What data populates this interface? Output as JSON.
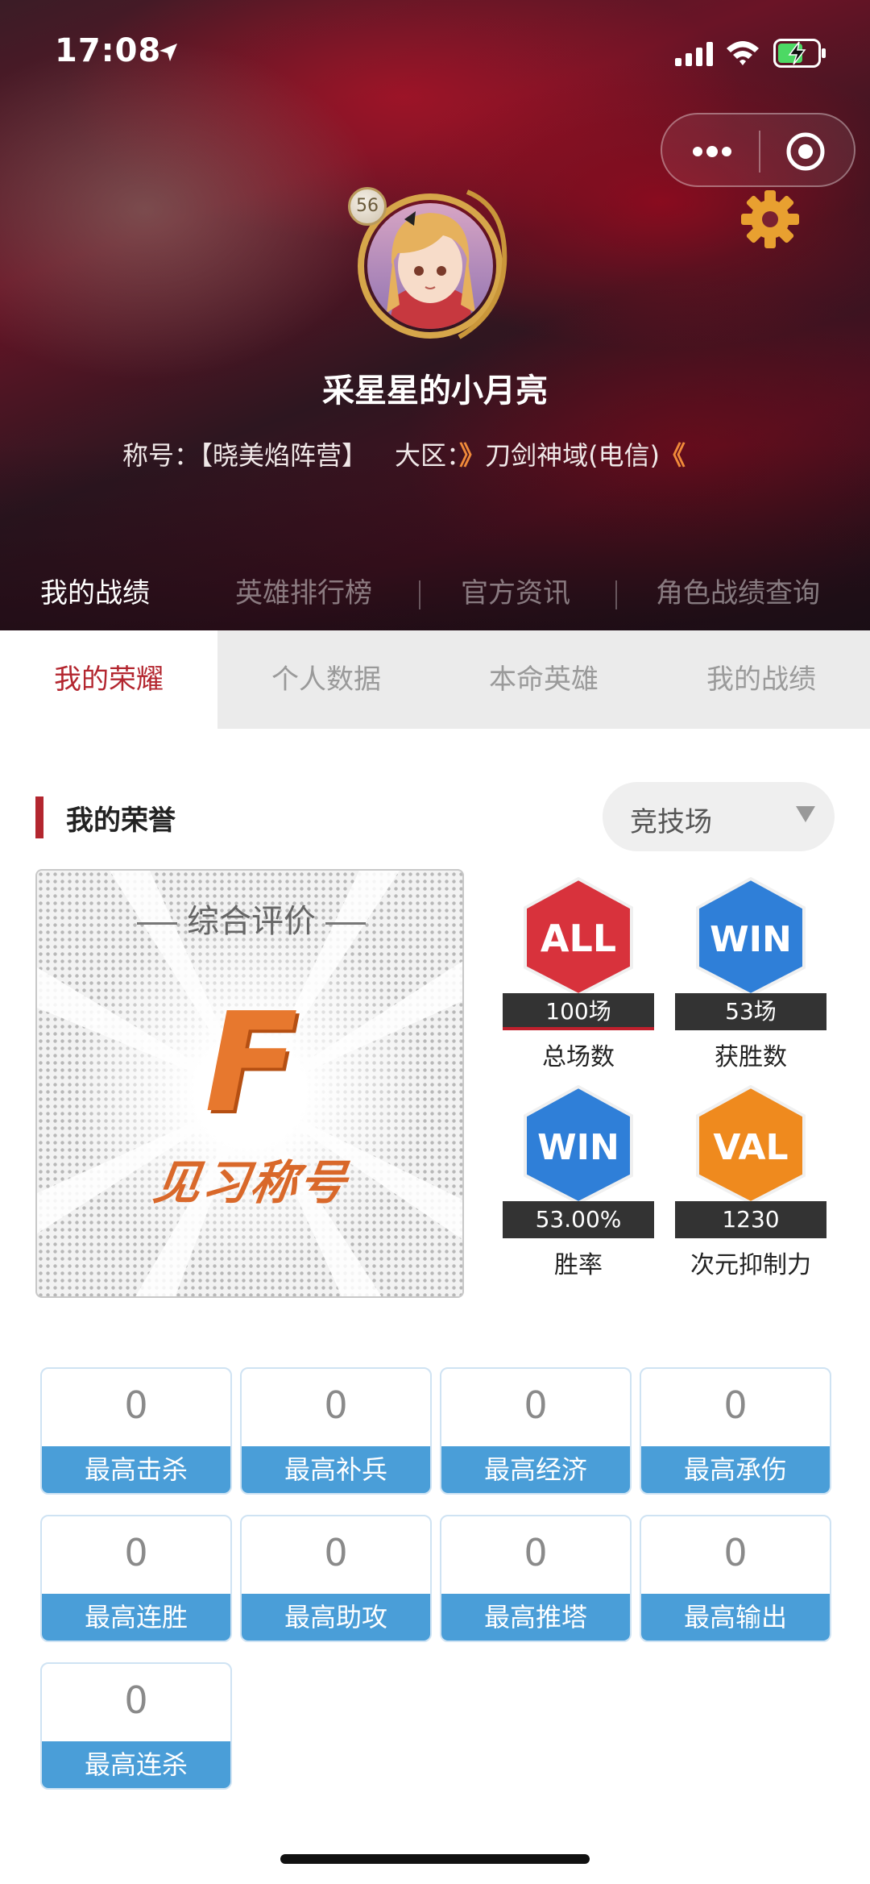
{
  "status_bar": {
    "time": "17:08"
  },
  "profile": {
    "level": "56",
    "username": "采星星的小月亮",
    "title_label": "称号：",
    "title_value": "【晓美焰阵营】",
    "region_label": "大区：",
    "region_left_mark": "》",
    "region_value": "刀剑神域(电信)",
    "region_right_mark": "《"
  },
  "top_tabs": [
    "我的战绩",
    "英雄排行榜",
    "官方资讯",
    "角色战绩查询"
  ],
  "sub_tabs": [
    "我的荣耀",
    "个人数据",
    "本命英雄",
    "我的战绩"
  ],
  "honor": {
    "section_title": "我的荣誉",
    "mode_selected": "竞技场",
    "evaluation": {
      "title": "综合评价",
      "grade": "F",
      "rank_title": "见习称号"
    },
    "stats": [
      {
        "badge": "ALL",
        "value": "100场",
        "label": "总场数",
        "color": "#d8323c"
      },
      {
        "badge": "WIN",
        "value": "53场",
        "label": "获胜数",
        "color": "#2f7fd8"
      },
      {
        "badge": "WIN",
        "value": "53.00%",
        "label": "胜率",
        "color": "#2f7fd8"
      },
      {
        "badge": "VAL",
        "value": "1230",
        "label": "次元抑制力",
        "color": "#ef8a1e"
      }
    ]
  },
  "records": [
    {
      "value": "0",
      "label": "最高击杀"
    },
    {
      "value": "0",
      "label": "最高补兵"
    },
    {
      "value": "0",
      "label": "最高经济"
    },
    {
      "value": "0",
      "label": "最高承伤"
    },
    {
      "value": "0",
      "label": "最高连胜"
    },
    {
      "value": "0",
      "label": "最高助攻"
    },
    {
      "value": "0",
      "label": "最高推塔"
    },
    {
      "value": "0",
      "label": "最高输出"
    },
    {
      "value": "0",
      "label": "最高连杀"
    }
  ],
  "icons": [
    "location-arrow-icon",
    "signal-icon",
    "wifi-icon",
    "battery-charging-icon",
    "more-dots-icon",
    "target-icon",
    "gear-icon"
  ]
}
